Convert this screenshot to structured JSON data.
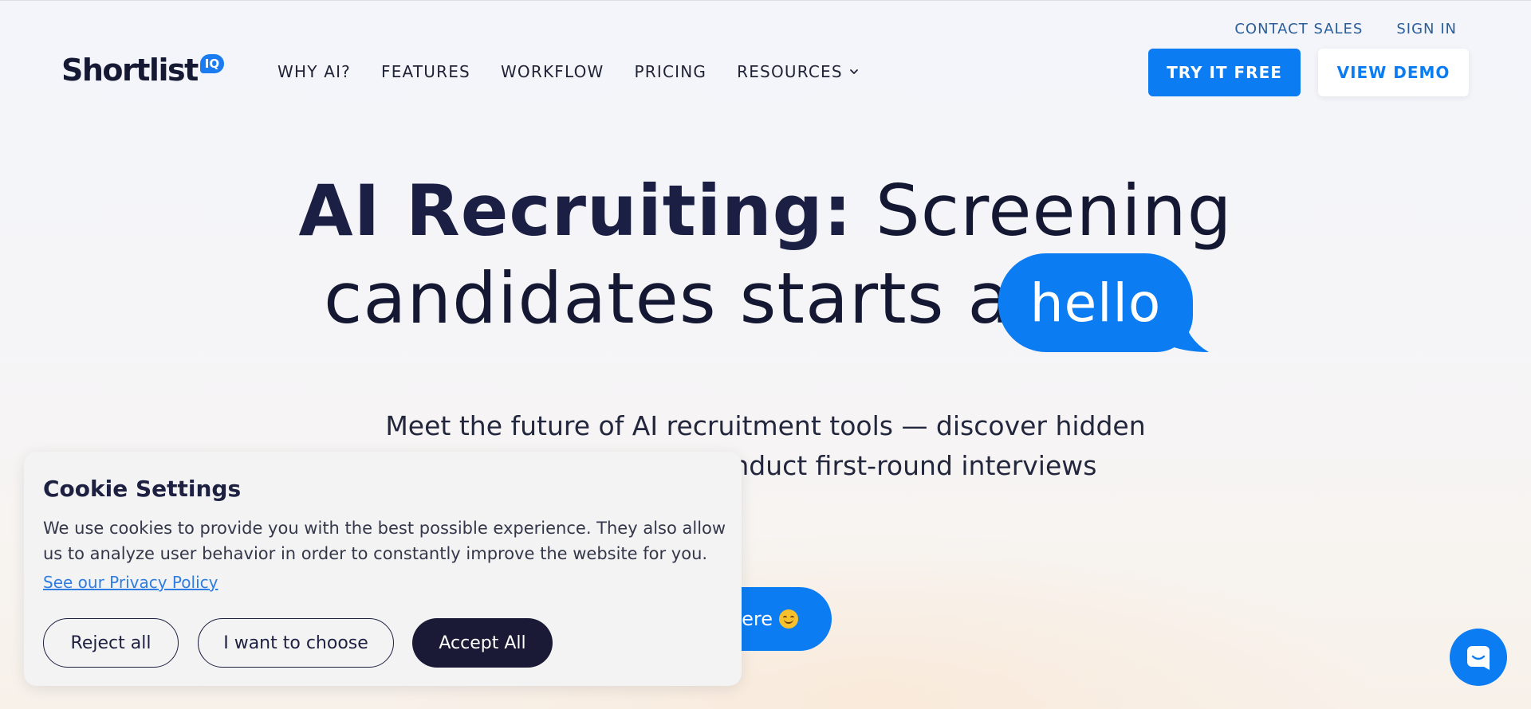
{
  "header": {
    "logo_text": "Shortlist",
    "logo_badge": "IQ",
    "util_nav": [
      "CONTACT SALES",
      "SIGN IN"
    ],
    "main_nav": [
      "WHY AI?",
      "FEATURES",
      "WORKFLOW",
      "PRICING",
      "RESOURCES"
    ],
    "try_button": "TRY IT FREE",
    "demo_button": "VIEW DEMO"
  },
  "hero": {
    "title_bold": "AI Recruiting:",
    "title_light": " Screening",
    "title_line2": "candidates starts at",
    "bubble_word": "hello",
    "subtitle_line1": "Meet the future of AI recruitment tools — discover hidden",
    "subtitle_line2": "conduct first-round interviews",
    "cta_partial": "ere"
  },
  "cookie": {
    "title": "Cookie Settings",
    "body": "We use cookies to provide you with the best possible experience. They also allow us to analyze user behavior in order to constantly improve the website for you.",
    "privacy_link": "See our Privacy Policy",
    "reject": "Reject all",
    "choose": "I want to choose",
    "accept": "Accept All"
  },
  "icons": {
    "resources_dropdown": "chevron-down-icon",
    "cta_emoji": "smiling-face-icon",
    "chat": "chat-icon"
  },
  "colors": {
    "brand_blue": "#0C7CF2",
    "dark_navy": "#1B1A36",
    "link_blue": "#2F7DE0"
  }
}
